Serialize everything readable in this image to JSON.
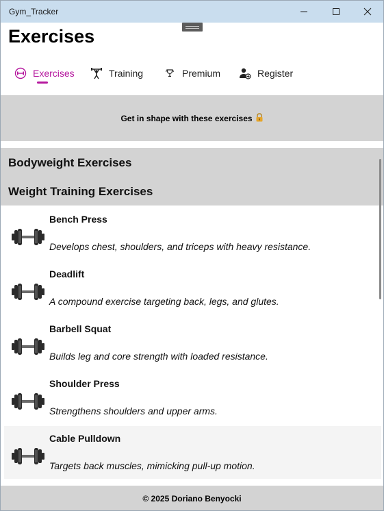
{
  "window": {
    "title": "Gym_Tracker",
    "controls": [
      "minimize-icon",
      "maximize-icon",
      "close-icon"
    ]
  },
  "page": {
    "title": "Exercises"
  },
  "tabs": [
    {
      "label": "Exercises",
      "icon": "dumbbell-circle-icon",
      "active": true
    },
    {
      "label": "Training",
      "icon": "weightlifter-icon",
      "active": false
    },
    {
      "label": "Premium",
      "icon": "trophy-icon",
      "active": false
    },
    {
      "label": "Register",
      "icon": "user-add-icon",
      "active": false
    }
  ],
  "banner": {
    "text": "Get in shape with these exercises",
    "icon": "lock-icon"
  },
  "sections": [
    {
      "label": "Bodyweight Exercises"
    },
    {
      "label": "Weight Training Exercises"
    }
  ],
  "exercises": [
    {
      "name": "Bench Press",
      "description": "Develops chest, shoulders, and triceps with heavy resistance.",
      "icon": "dumbbell-icon"
    },
    {
      "name": "Deadlift",
      "description": "A compound exercise targeting back, legs, and glutes.",
      "icon": "dumbbell-icon"
    },
    {
      "name": "Barbell Squat",
      "description": "Builds leg and core strength with loaded resistance.",
      "icon": "dumbbell-icon"
    },
    {
      "name": "Shoulder Press",
      "description": "Strengthens shoulders and upper arms.",
      "icon": "dumbbell-icon"
    },
    {
      "name": "Cable Pulldown",
      "description": "Targets back muscles, mimicking pull-up motion.",
      "icon": "dumbbell-icon",
      "selected": true
    }
  ],
  "footer": {
    "text": "© 2025 Doriano Benyocki"
  },
  "colors": {
    "accent": "#b5179e",
    "titlebar": "#c9ddee",
    "band": "#d3d3d3"
  }
}
